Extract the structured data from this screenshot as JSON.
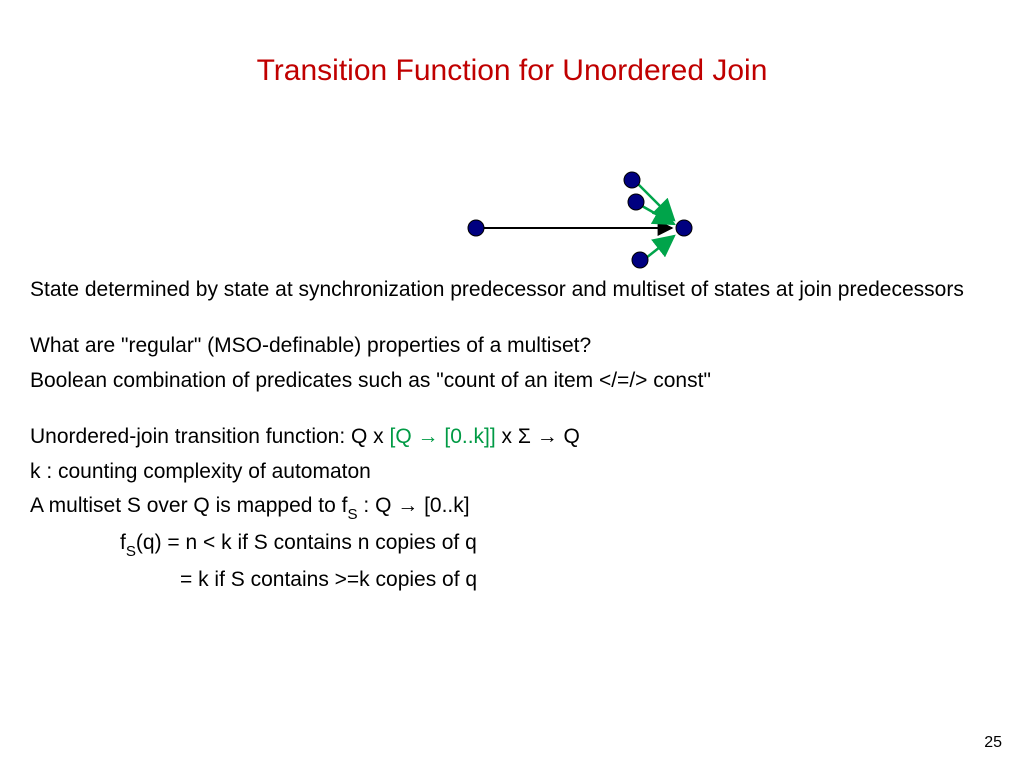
{
  "title": "Transition Function for Unordered Join",
  "body": {
    "p1": "State determined by state at synchronization predecessor and multiset of states at join predecessors",
    "p2": "What are \"regular\" (MSO-definable) properties of a multiset?",
    "p3": "Boolean combination of predicates such as \"count of an item </=/> const\"",
    "p4_a": "Unordered-join transition function: Q x ",
    "p4_b": "[Q → [0..k]]",
    "p4_c": " x Σ → Q",
    "p5": "k : counting complexity of automaton",
    "p6_a": "A multiset S over Q is mapped to f",
    "p6_sub": "S",
    "p6_b": " : Q → [0..k]",
    "p7_a": "f",
    "p7_sub": "S",
    "p7_b": "(q) = n < k if S contains n copies of q",
    "p8": "= k if S contains >=k copies of q"
  },
  "page_number": "25"
}
